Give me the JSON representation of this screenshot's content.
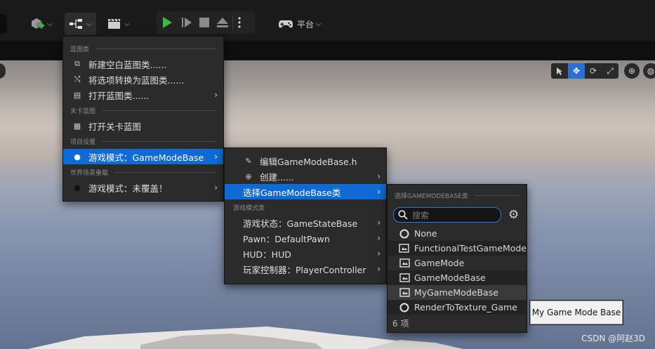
{
  "toolbar": {
    "play_label": "",
    "platform_label": "平台"
  },
  "main_menu": {
    "sections": [
      {
        "title": "蓝图类",
        "items": [
          {
            "label": "新建空白蓝图类......",
            "icon": "blueprint-new-icon"
          },
          {
            "label": "将选项转换为蓝图类......",
            "icon": "convert-icon"
          },
          {
            "label": "打开蓝图类......",
            "icon": "open-blueprint-icon",
            "submenu": true
          }
        ]
      },
      {
        "title": "关卡蓝图",
        "items": [
          {
            "label": "打开关卡蓝图",
            "icon": "level-blueprint-icon"
          }
        ]
      },
      {
        "title": "项目设置",
        "items": [
          {
            "label": "游戏模式：GameModeBase",
            "icon": "bullet-icon",
            "submenu": true,
            "selected": true
          }
        ]
      },
      {
        "title": "世界场景重载",
        "items": [
          {
            "label": "游戏模式：未覆盖！",
            "icon": "bullet-icon",
            "submenu": true
          }
        ]
      }
    ]
  },
  "sub_menu": {
    "items": [
      {
        "label": "编辑GameModeBase.h",
        "icon": "edit-icon"
      },
      {
        "label": "创建......",
        "icon": "plus-circle-icon",
        "submenu": true
      },
      {
        "label": "选择GameModeBase类",
        "submenu": true,
        "selected": true
      }
    ],
    "section_title": "游戏模式类",
    "class_items": [
      {
        "label": "游戏状态：GameStateBase",
        "submenu": true
      },
      {
        "label": "Pawn：DefaultPawn",
        "submenu": true
      },
      {
        "label": "HUD：HUD",
        "submenu": true
      },
      {
        "label": "玩家控制器：PlayerController",
        "submenu": true
      }
    ]
  },
  "class_picker": {
    "title": "选择GAMEMODEBASE类",
    "search_placeholder": "搜索",
    "items": [
      {
        "label": "None",
        "icon": "circle-icon"
      },
      {
        "label": "FunctionalTestGameMode",
        "icon": "class-icon"
      },
      {
        "label": "GameMode",
        "icon": "class-icon"
      },
      {
        "label": "GameModeBase",
        "icon": "class-icon"
      },
      {
        "label": "MyGameModeBase",
        "icon": "class-icon",
        "hovered": true
      },
      {
        "label": "RenderToTexture_Game",
        "icon": "circle-icon"
      }
    ],
    "count_label": "6 项"
  },
  "tooltip": {
    "text": "My Game Mode Base"
  },
  "watermark": {
    "text": "CSDN @阿赵3D"
  },
  "colors": {
    "accent": "#0f6ad6",
    "play_green": "#3fb83f"
  }
}
